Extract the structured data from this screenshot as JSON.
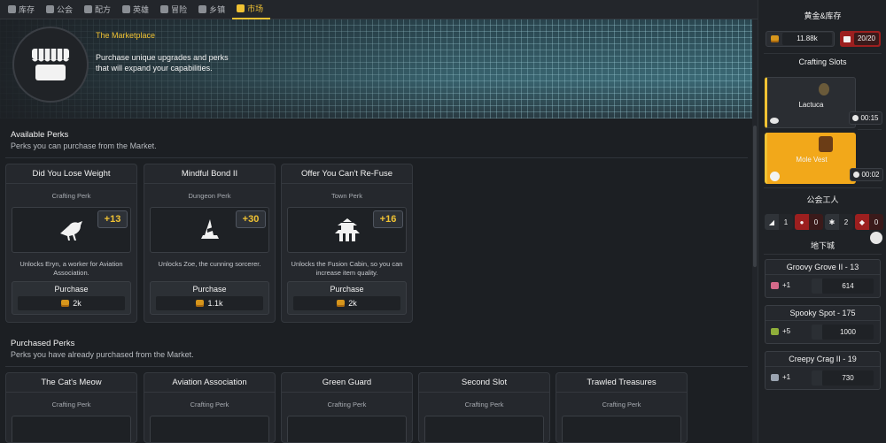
{
  "nav": {
    "tabs": [
      {
        "label": "库存",
        "icon": "inventory-icon"
      },
      {
        "label": "公会",
        "icon": "guild-icon"
      },
      {
        "label": "配方",
        "icon": "recipe-icon"
      },
      {
        "label": "英雄",
        "icon": "hero-icon"
      },
      {
        "label": "冒险",
        "icon": "swords-icon"
      },
      {
        "label": "乡镇",
        "icon": "town-icon"
      },
      {
        "label": "市场",
        "icon": "market-icon",
        "active": true
      }
    ]
  },
  "banner": {
    "title": "The Marketplace",
    "description": "Purchase unique upgrades and perks that will expand your capabilities."
  },
  "available": {
    "title": "Available Perks",
    "subtitle": "Perks you can purchase from the Market.",
    "perks": [
      {
        "title": "Did You Lose Weight",
        "type": "Crafting Perk",
        "bonus": "+13",
        "icon": "raven-icon",
        "desc": "Unlocks Eryn, a worker for Aviation Association.",
        "button": "Purchase",
        "cost": "2k"
      },
      {
        "title": "Mindful Bond II",
        "type": "Dungeon Perk",
        "bonus": "+30",
        "icon": "witch-hat-icon",
        "desc": "Unlocks Zoe, the cunning sorcerer.",
        "button": "Purchase",
        "cost": "1.1k"
      },
      {
        "title": "Offer You Can't Re-Fuse",
        "type": "Town Perk",
        "bonus": "+16",
        "icon": "pagoda-icon",
        "desc": "Unlocks the Fusion Cabin, so you can increase item quality.",
        "button": "Purchase",
        "cost": "2k"
      }
    ]
  },
  "purchased": {
    "title": "Purchased Perks",
    "subtitle": "Perks you have already purchased from the Market.",
    "perks": [
      {
        "title": "The Cat's Meow",
        "type": "Crafting Perk"
      },
      {
        "title": "Aviation Association",
        "type": "Crafting Perk"
      },
      {
        "title": "Green Guard",
        "type": "Crafting Perk"
      },
      {
        "title": "Second Slot",
        "type": "Crafting Perk"
      },
      {
        "title": "Trawled Treasures",
        "type": "Crafting Perk"
      }
    ]
  },
  "sidebar": {
    "gold_title": "黄金&库存",
    "gold": "11.88k",
    "inventory": "20/20",
    "crafting_title": "Crafting Slots",
    "slots": [
      {
        "name": "Lactuca",
        "time": "00:15",
        "state": "idle"
      },
      {
        "name": "Mole Vest",
        "time": "00:02",
        "state": "active"
      }
    ],
    "workers_title": "公会工人",
    "workers": [
      {
        "icon": "bird-worker-icon",
        "count": "1",
        "alert": false
      },
      {
        "icon": "mushroom-worker-icon",
        "count": "0",
        "alert": true
      },
      {
        "icon": "paw-worker-icon",
        "count": "2",
        "alert": false
      },
      {
        "icon": "fish-worker-icon",
        "count": "0",
        "alert": true
      }
    ],
    "dungeon_title": "地下城",
    "dungeons": [
      {
        "name": "Groovy Grove II - 13",
        "bonus": "+1",
        "value": "614",
        "color": "#d46a8a"
      },
      {
        "name": "Spooky Spot - 175",
        "bonus": "+5",
        "value": "1000",
        "color": "#8fae3a"
      },
      {
        "name": "Creepy Crag II - 19",
        "bonus": "+1",
        "value": "730",
        "color": "#9aa3b0"
      }
    ]
  },
  "colors": {
    "accent": "#f0c233",
    "alert": "#9c1f1f",
    "slot_active": "#f2a81a"
  }
}
